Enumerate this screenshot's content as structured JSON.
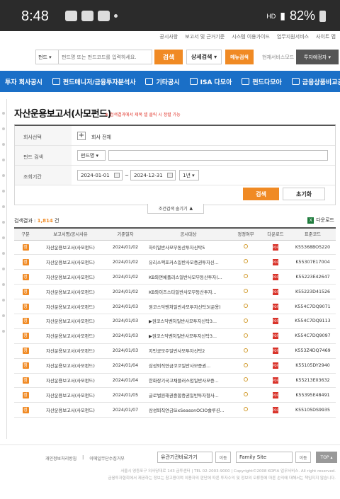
{
  "status": {
    "time": "8:48",
    "network": "HD",
    "battery": "82%"
  },
  "topnav": [
    "공시사항",
    "보고서 및 근거기준",
    "시스템 이용가이드",
    "업무지원서비스",
    "사이트 맵"
  ],
  "search": {
    "select": "펀드",
    "placeholder": "펀드명 또는 펀드코드를 입력하세요.",
    "button": "검색",
    "detail": "상세검색",
    "menu": "메뉴검색",
    "other_label": "현재서비스모드",
    "invest": "투자예정자"
  },
  "bluenav": [
    "투자 회사공시",
    "펀드매니저/금융투자분석사",
    "기타공시",
    "ISA 다모아",
    "펀드다모아",
    "금융상품비교공시"
  ],
  "page": {
    "title": "자산운용보고서(사모펀드)",
    "note": "※ 검색결과에서 제목 셀 클릭 시 정렬 가능"
  },
  "form": {
    "company_label": "회사선택",
    "company_value": "회사 전체",
    "fund_label": "펀드 검색",
    "fund_select": "펀드명",
    "period_label": "조회기간",
    "date_from": "2024-01-01",
    "date_to": "2024-12-31",
    "period_select": "1년",
    "find": "검색",
    "reset": "초기화",
    "toggle": "조건검색 숨기기"
  },
  "results": {
    "label": "검색결과 :",
    "count": "1,814",
    "unit": "건",
    "download": "다운로드"
  },
  "table": {
    "headers": [
      "구분",
      "보고서명/공시사유",
      "기준일자",
      "공시대상",
      "정정여부",
      "다운로드",
      "표준코드"
    ],
    "rows": [
      {
        "badge": "정",
        "report": "자산운용보고서(사모펀드)",
        "date": "2024/01/02",
        "target": "하이일반사모부동산투자신탁5",
        "code": "K55368BO5220"
      },
      {
        "badge": "정",
        "report": "자산운용보고서(사모펀드)",
        "date": "2024/01/02",
        "target": "유리스맥포커스일반사모증권투자신...",
        "code": "K55307E17004"
      },
      {
        "badge": "정",
        "report": "자산운용보고서(사모펀드)",
        "date": "2024/01/02",
        "target": "KB와면체플러스일반사모부동산투자(...",
        "code": "K55223E42647"
      },
      {
        "badge": "정",
        "report": "자산운용보고서(사모펀드)",
        "date": "2024/01/02",
        "target": "KB와이즈스타일반사모부동산투자...",
        "code": "K55223D41526"
      },
      {
        "badge": "정",
        "report": "자산운용보고서(사모펀드)",
        "date": "2024/01/03",
        "target": "원코스닥벤처일반사모투자신탁3(운용)",
        "code": "K554C7DQ9071"
      },
      {
        "badge": "정",
        "report": "자산운용보고서(사모펀드)",
        "date": "2024/01/03",
        "target": "▶원코스닥벤처일반사모투자신탁3...",
        "code": "K554C7DQ9113"
      },
      {
        "badge": "정",
        "report": "자산운용보고서(사모펀드)",
        "date": "2024/01/03",
        "target": "▶원코스닥벤처일반사모투자신탁3...",
        "code": "K554C7DQ9097"
      },
      {
        "badge": "정",
        "report": "자산운용보고서(사모펀드)",
        "date": "2024/01/03",
        "target": "지만공모주일반사모투자신탁2",
        "code": "K553Z4DQ7469"
      },
      {
        "badge": "정",
        "report": "자산운용보고서(사모펀드)",
        "date": "2024/01/04",
        "target": "삼성퇴직연금코코일반사모증권...",
        "code": "K55105DY2940"
      },
      {
        "badge": "정",
        "report": "자산운용보고서(사모펀드)",
        "date": "2024/01/04",
        "target": "한화장기국고채플러스업일반사모증...",
        "code": "K55213E03632"
      },
      {
        "badge": "정",
        "report": "자산운용보고서(사모펀드)",
        "date": "2024/01/05",
        "target": "글로벌원해권중합증권일반투자형사...",
        "code": "K55395E48491"
      },
      {
        "badge": "정",
        "report": "자산운용보고서(사모펀드)",
        "date": "2024/01/07",
        "target": "삼성퇴직연금SixSeasonOCIO솔루션...",
        "code": "K55105DS9935"
      }
    ]
  },
  "footer": {
    "links": [
      "개인정보처리방침",
      "이메일무단수집거부"
    ],
    "related": "유관기관바로가기",
    "family": "Family Site",
    "go": "이동",
    "top": "TOP",
    "addr1": "서울시 영등포구 의사당대로 143 금투센터 | TEL 02-2003-9000 | Copyright©2008 KOFIA 업무서비스. All right reserved.",
    "addr2": "금융투자협회에서 제공하는 정보는 참고용이며 이용자의 판단에 따른 투자수익 및 정보의 오류등에 따른 손익에 대해서는 책임지지 않습니다."
  }
}
